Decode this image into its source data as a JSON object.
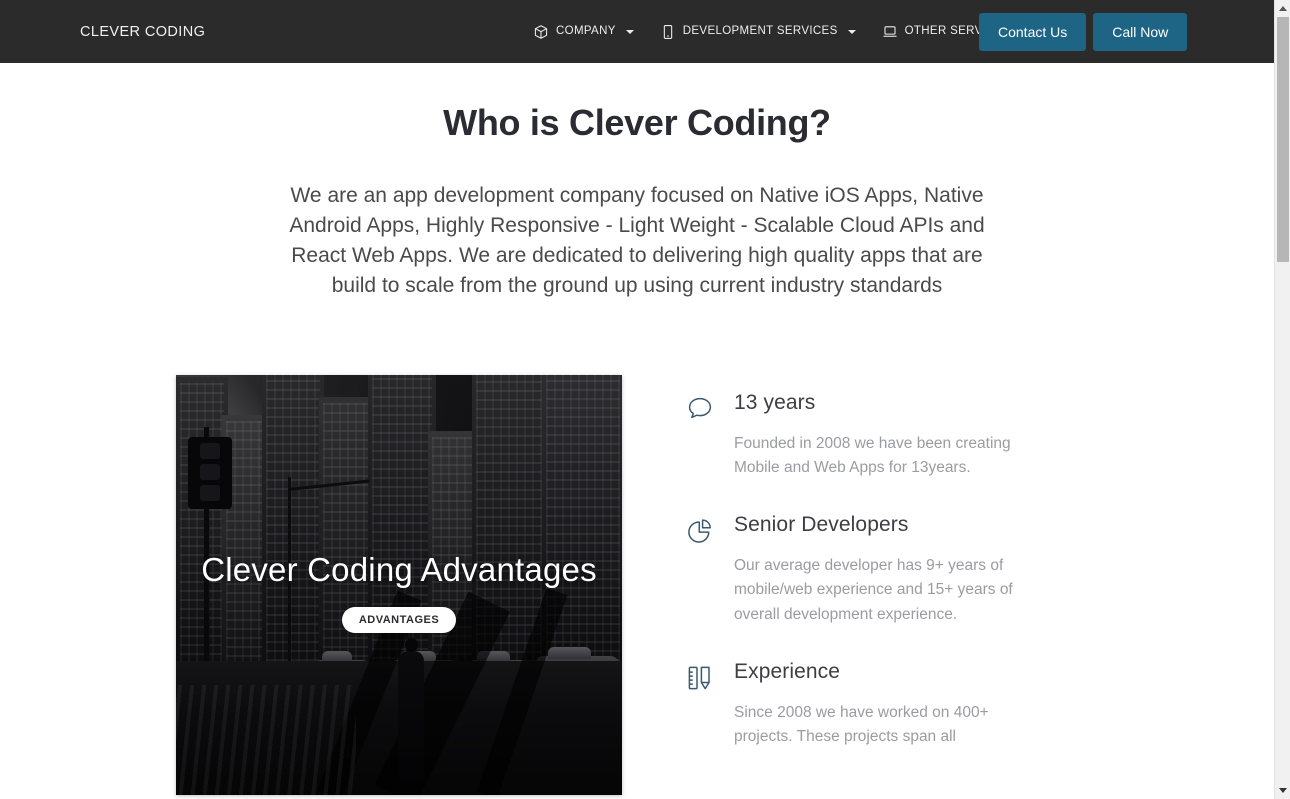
{
  "navbar": {
    "brand": "CLEVER CODING",
    "items": [
      {
        "label": "COMPANY",
        "icon": "cube-icon",
        "caret": true
      },
      {
        "label": "DEVELOPMENT SERVICES",
        "icon": "mobile-phone-icon",
        "caret": true
      },
      {
        "label": "OTHER SERVICES",
        "icon": "laptop-icon",
        "caret": true
      }
    ],
    "buttons": [
      {
        "label": "Contact Us",
        "name": "contact-us-button"
      },
      {
        "label": "Call Now",
        "name": "call-now-button"
      }
    ],
    "background_color": "#2b2b2b",
    "button_color": "#1d6485"
  },
  "hero": {
    "heading": "Who is Clever Coding?",
    "paragraph": "We are an app development company focused on Native iOS Apps, Native Android Apps, Highly Responsive - Light Weight - Scalable Cloud APIs and React Web Apps. We are dedicated to delivering high quality apps that are build to scale from the ground up using current industry standards"
  },
  "image_card": {
    "title": "Clever Coding Advantages",
    "badge": "ADVANTAGES",
    "image_description": "black-and-white city street scene"
  },
  "features": [
    {
      "icon": "speech-bubble-icon",
      "title": "13 years",
      "text": "Founded in 2008 we have been creating Mobile and Web Apps for 13years."
    },
    {
      "icon": "pie-chart-icon",
      "title": "Senior Developers",
      "text": "Our average developer has 9+ years of mobile/web experience and 15+ years of overall development experience."
    },
    {
      "icon": "ruler-pencil-icon",
      "title": "Experience",
      "text": "Since 2008 we have worked on 400+ projects. These projects span all"
    }
  ],
  "colors": {
    "icon": "#3a5a6e",
    "heading": "#2b2b33",
    "muted_text": "#9b9ba3"
  }
}
